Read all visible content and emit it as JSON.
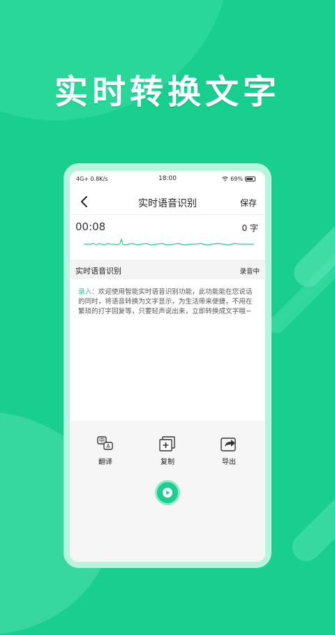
{
  "hero": {
    "title": "实时转换文字"
  },
  "status": {
    "network": "4G+ 0.8K/s",
    "time": "18:00",
    "battery": "69%"
  },
  "header": {
    "title": "实时语音识别",
    "save_label": "保存"
  },
  "recorder": {
    "timer": "00:08",
    "char_count": "0 字"
  },
  "section": {
    "title": "实时语音识别",
    "state": "录音中"
  },
  "transcript": {
    "label": "录入：",
    "text": "欢迎使用智能实时语音识别功能，此功能能在您说话的同时，将语音转换为文字显示，为生活带来便捷，不用在繁琐的打字回复等，只要轻声说出来，立即转换成文字哦~"
  },
  "actions": [
    {
      "label": "翻译",
      "icon": "translate-icon"
    },
    {
      "label": "复制",
      "icon": "copy-icon"
    },
    {
      "label": "导出",
      "icon": "export-icon"
    }
  ],
  "colors": {
    "brand": "#19cf8f",
    "accent": "#1ccf8f"
  }
}
